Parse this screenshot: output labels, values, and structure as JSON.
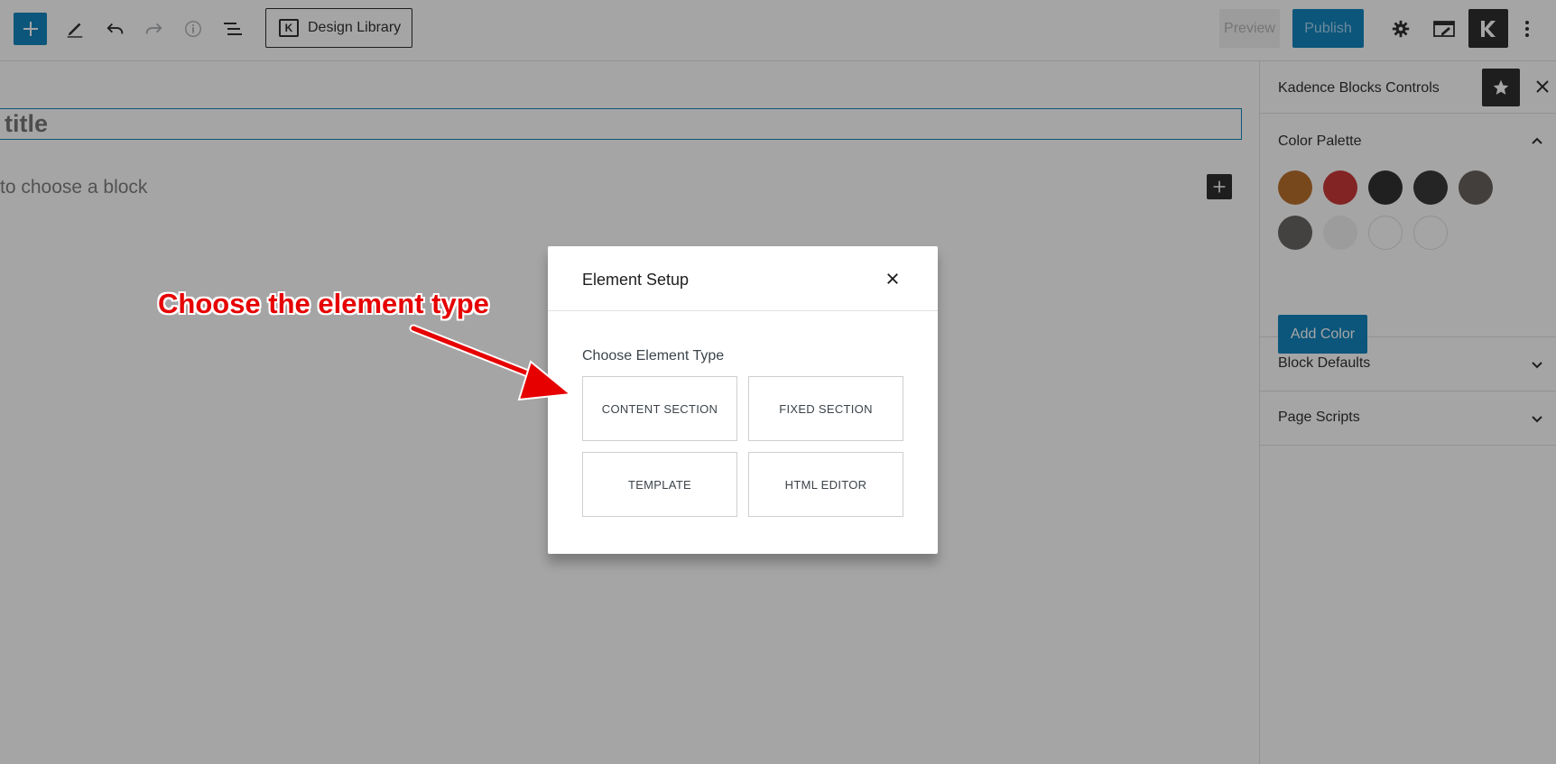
{
  "toolbar": {
    "design_library_label": "Design Library",
    "preview_label": "Preview",
    "publish_label": "Publish"
  },
  "editor": {
    "title_text": "title",
    "block_hint": "to choose a block"
  },
  "sidebar": {
    "title": "Kadence Blocks Controls",
    "color_palette_title": "Color Palette",
    "swatches": [
      "#b5651d",
      "#c62828",
      "#222222",
      "#2a2a2a",
      "#5b5651",
      "#5e5b58",
      "#f0f0f0",
      "#ffffff",
      "#ffffff"
    ],
    "add_color_label": "Add Color",
    "block_defaults_title": "Block Defaults",
    "page_scripts_title": "Page Scripts"
  },
  "modal": {
    "title": "Element Setup",
    "choose_label": "Choose Element Type",
    "options": [
      "CONTENT SECTION",
      "FIXED SECTION",
      "TEMPLATE",
      "HTML EDITOR"
    ]
  },
  "annotation": {
    "text": "Choose the element type",
    "color": "#e60000"
  },
  "colors": {
    "accent": "#007cba",
    "dark": "#1e1e1e"
  }
}
